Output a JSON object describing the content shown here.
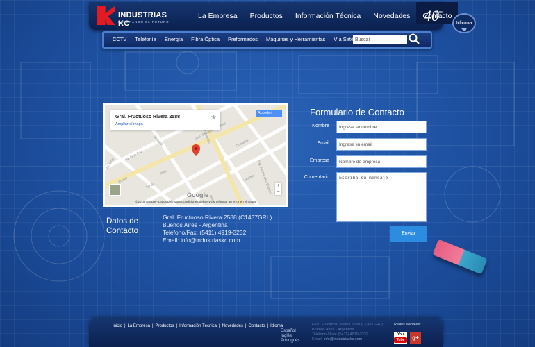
{
  "header": {
    "brand": "INDUSTRIAS KC",
    "tagline": "DUJERANDO EL FUTURO",
    "anniversary_number": "40",
    "anniversary_suffix": "años",
    "language_button": "Idioma",
    "nav": [
      "La Empresa",
      "Productos",
      "Información Técnica",
      "Novedades",
      "Contacto"
    ],
    "active_nav": "Contacto"
  },
  "subnav": {
    "items": [
      "CCTV",
      "Telefonía",
      "Energía",
      "Fibra Óptica",
      "Preformados",
      "Máquinas y Herramientas",
      "Vía Satélite"
    ],
    "search_placeholder": "Buscar"
  },
  "map": {
    "place_title": "Gral. Fructuoso Rivera 2588",
    "enlarge_link": "Ampliar el mapa",
    "signin_button": "Acceder",
    "zoom_in": "+",
    "zoom_out": "−",
    "google": "Google",
    "footer": "©2015 Google - Datos del mapa     Condiciones del servicio     Informar un error en el mapa",
    "streets": [
      "Gral. Fructuoso Rivera",
      "Av. Gral Paz",
      "Av. Cruz",
      "Murguiondo",
      "Corrales",
      "Saladillo",
      "Mendez",
      "Pola",
      "Tandil",
      "Araujo",
      "Oliva",
      "Ing. Fernandez Blanco"
    ]
  },
  "contact_data": {
    "title": "Datos de Contacto",
    "lines": [
      "Gral. Fructuoso Rivera 2588 (C1437GRL)",
      "Buenos Aires - Argentina",
      "Teléfono/Fax: (5411) 4919-3232",
      "Email: info@industriaskc.com"
    ]
  },
  "form": {
    "title": "Formulario de Contacto",
    "fields": [
      {
        "label": "Nombre",
        "placeholder": "Ingrese su nombre"
      },
      {
        "label": "Email",
        "placeholder": "Ingrese su email"
      },
      {
        "label": "Empresa",
        "placeholder": "Nombre de empresa"
      }
    ],
    "comment_label": "Comentario",
    "comment_placeholder": "Escriba su mensaje",
    "submit": "Enviar"
  },
  "footer": {
    "nav": [
      "Inicio",
      "La Empresa",
      "Productos",
      "Información Técnica",
      "Novedades",
      "Contacto",
      "Idioma"
    ],
    "languages": [
      "Español",
      "Inglés",
      "Portugués"
    ],
    "address_lines": [
      "Gral. Fructuoso Rivera 2588 (C1437GRL)",
      "Buenos Aires - Argentina",
      "Teléfono / Fax: (5411) 4919-3232"
    ],
    "email_label": "Email:",
    "email": "info@industriaskc.com",
    "social_title": "Redes sociales:",
    "youtube_top": "You",
    "youtube_bottom": "Tube",
    "gplus": "g+"
  },
  "colors": {
    "brand_red": "#e21b22",
    "button_blue": "#2c8ce0",
    "background": "#1b4d9e"
  }
}
